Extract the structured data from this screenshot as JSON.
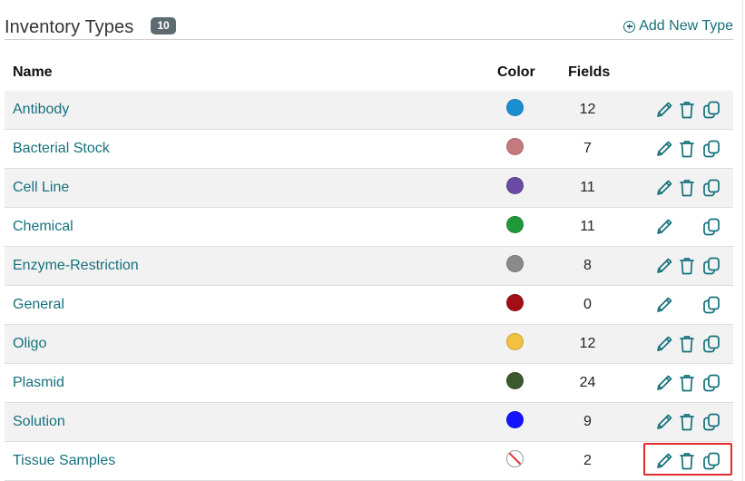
{
  "header": {
    "title": "Inventory Types",
    "count": "10",
    "add_label": "Add New Type"
  },
  "columns": {
    "name": "Name",
    "color": "Color",
    "fields": "Fields"
  },
  "rows": [
    {
      "name": "Antibody",
      "color": "#1a8fd0",
      "fields": "12",
      "can_delete": true
    },
    {
      "name": "Bacterial Stock",
      "color": "#c47a7e",
      "fields": "7",
      "can_delete": true
    },
    {
      "name": "Cell Line",
      "color": "#6a4aa5",
      "fields": "11",
      "can_delete": true
    },
    {
      "name": "Chemical",
      "color": "#1f9a3b",
      "fields": "11",
      "can_delete": false
    },
    {
      "name": "Enzyme-Restriction",
      "color": "#8a8a8a",
      "fields": "8",
      "can_delete": true
    },
    {
      "name": "General",
      "color": "#a30f16",
      "fields": "0",
      "can_delete": false
    },
    {
      "name": "Oligo",
      "color": "#f2c140",
      "fields": "12",
      "can_delete": true
    },
    {
      "name": "Plasmid",
      "color": "#3a5a2c",
      "fields": "24",
      "can_delete": true
    },
    {
      "name": "Solution",
      "color": "#1414ff",
      "fields": "9",
      "can_delete": true
    },
    {
      "name": "Tissue Samples",
      "color": "none",
      "fields": "2",
      "can_delete": true
    }
  ],
  "icons": {
    "edit": "pencil-icon",
    "delete": "trash-icon",
    "duplicate": "copy-icon",
    "add": "plus-circle-icon",
    "no_color": "no-color-icon"
  },
  "theme": {
    "link": "#16717d",
    "highlight": "#e12b2b"
  }
}
